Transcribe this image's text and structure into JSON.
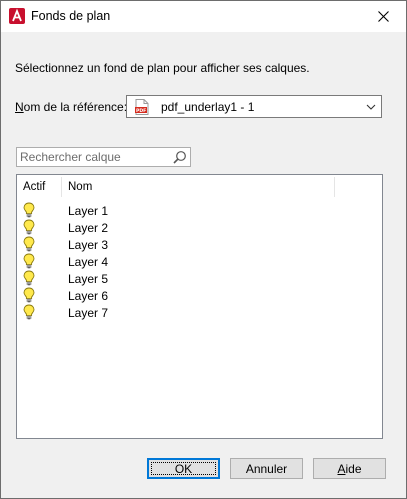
{
  "window": {
    "title": "Fonds de plan",
    "app_icon": "autocad-icon",
    "close_icon": "close-icon"
  },
  "instruction": "Sélectionnez un fond de plan pour afficher ses calques.",
  "reference": {
    "label_first": "N",
    "label_rest": "om de la référence:",
    "selected": "pdf_underlay1 - 1",
    "icon": "pdf-file-icon"
  },
  "search": {
    "placeholder": "Rechercher calque",
    "value": ""
  },
  "layer_table": {
    "columns": [
      "Actif",
      "Nom"
    ],
    "rows": [
      {
        "active_icon": "lightbulb-on-icon",
        "name": "Layer 1"
      },
      {
        "active_icon": "lightbulb-on-icon",
        "name": "Layer 2"
      },
      {
        "active_icon": "lightbulb-on-icon",
        "name": "Layer 3"
      },
      {
        "active_icon": "lightbulb-on-icon",
        "name": "Layer 4"
      },
      {
        "active_icon": "lightbulb-on-icon",
        "name": "Layer 5"
      },
      {
        "active_icon": "lightbulb-on-icon",
        "name": "Layer 6"
      },
      {
        "active_icon": "lightbulb-on-icon",
        "name": "Layer 7"
      }
    ]
  },
  "buttons": {
    "ok": "OK",
    "cancel": "Annuler",
    "help": "Aide"
  },
  "colors": {
    "accent": "#0078d7",
    "autocad_red": "#c8102e",
    "bulb_yellow": "#ffe94d"
  }
}
